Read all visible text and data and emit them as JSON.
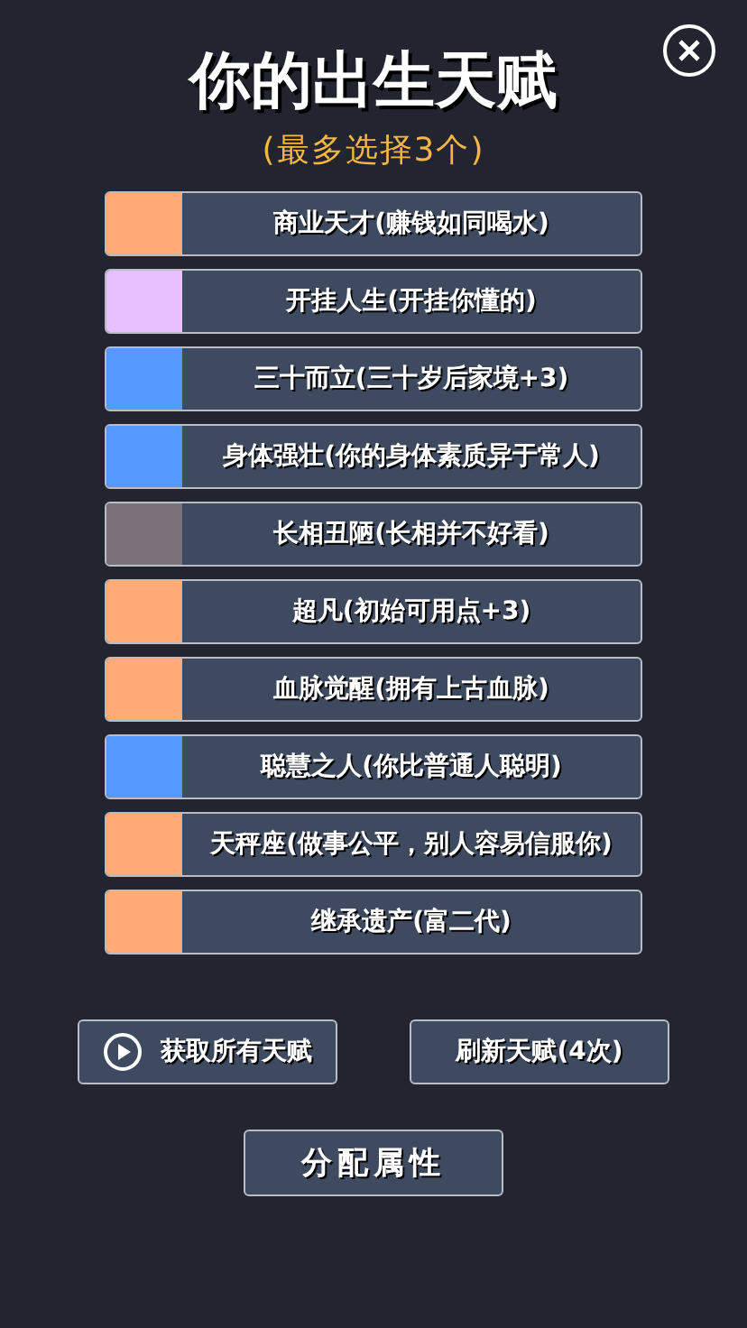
{
  "title": "你的出生天赋",
  "subtitle": "(最多选择3个)",
  "talents": [
    {
      "label": "商业天才(赚钱如同喝水)",
      "color": "#ffab76"
    },
    {
      "label": "开挂人生(开挂你懂的)",
      "color": "#e8c0ff"
    },
    {
      "label": "三十而立(三十岁后家境+3)",
      "color": "#5599ff"
    },
    {
      "label": "身体强壮(你的身体素质异于常人)",
      "color": "#5599ff"
    },
    {
      "label": "长相丑陋(长相并不好看)",
      "color": "#7a7278"
    },
    {
      "label": "超凡(初始可用点+3)",
      "color": "#ffab76"
    },
    {
      "label": "血脉觉醒(拥有上古血脉)",
      "color": "#ffab76"
    },
    {
      "label": "聪慧之人(你比普通人聪明)",
      "color": "#5599ff"
    },
    {
      "label": "天秤座(做事公平，别人容易信服你)",
      "color": "#ffab76"
    },
    {
      "label": "继承遗产(富二代)",
      "color": "#ffab76"
    }
  ],
  "buttons": {
    "get_all": "获取所有天赋",
    "refresh": "刷新天赋(4次)",
    "assign": "分配属性"
  }
}
